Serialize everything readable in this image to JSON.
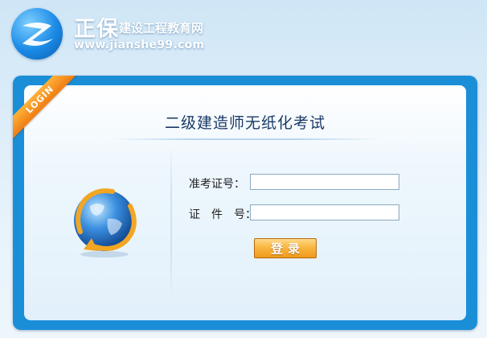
{
  "header": {
    "brand_main": "正保",
    "brand_sub": "建设工程教育网",
    "url": "www.jianshe99.com"
  },
  "login": {
    "ribbon": "LOGIN",
    "title": "二级建造师无纸化考试",
    "ticket_label": "准考证号：",
    "ticket_value": "",
    "id_label": "证　件　号：",
    "id_value": "",
    "submit_label": "登录"
  },
  "colors": {
    "panel_border": "#1b8ed8",
    "button": "#f9b640",
    "ribbon": "#ef7d12"
  },
  "icons": {
    "logo": "zhengbao-logo",
    "globe": "globe-arrow-icon"
  }
}
